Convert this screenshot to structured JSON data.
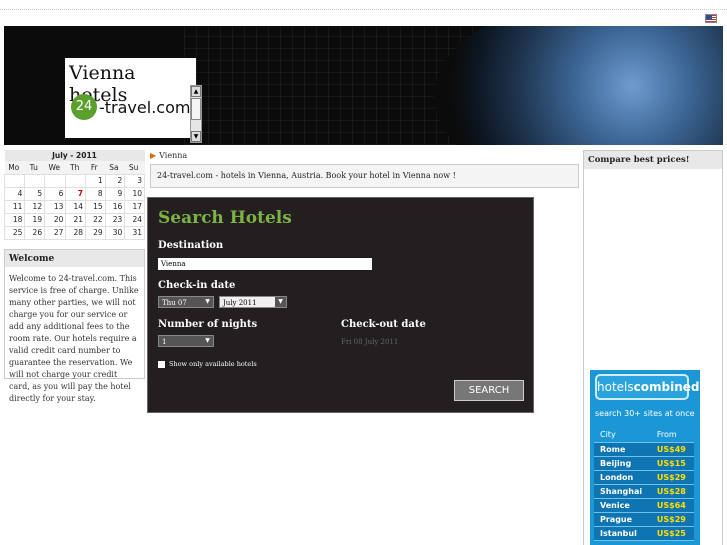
{
  "header": {
    "title": "Vienna hotels",
    "brand_number": "24",
    "brand_text": "-travel.com"
  },
  "calendar": {
    "month": "July - 2011",
    "days": [
      "Mo",
      "Tu",
      "We",
      "Th",
      "Fr",
      "Sa",
      "Su"
    ],
    "weeks": [
      [
        "",
        "",
        "",
        "",
        "1",
        "2",
        "3"
      ],
      [
        "4",
        "5",
        "6",
        "7",
        "8",
        "9",
        "10"
      ],
      [
        "11",
        "12",
        "13",
        "14",
        "15",
        "16",
        "17"
      ],
      [
        "18",
        "19",
        "20",
        "21",
        "22",
        "23",
        "24"
      ],
      [
        "25",
        "26",
        "27",
        "28",
        "29",
        "30",
        "31"
      ]
    ],
    "today": "7"
  },
  "welcome": {
    "title": "Welcome",
    "text": "Welcome to 24-travel.com. This service is free of charge. Unlike many other parties, we will not charge you for our service or add any additional fees to the room rate. Our hotels require a valid credit card number to guarantee the reservation. We will not charge your credit card, as you will pay the hotel directly for your stay."
  },
  "breadcrumb": "Vienna",
  "intro": "24-travel.com - hotels in Vienna, Austria. Book your hotel in Vienna now !",
  "search": {
    "title": "Search Hotels",
    "destination_label": "Destination",
    "destination_value": "Vienna",
    "checkin_label": "Check-in date",
    "checkin_day": "Thu 07",
    "checkin_month": "July 2011",
    "nights_label": "Number of nights",
    "nights_value": "1",
    "checkout_label": "Check-out date",
    "checkout_value": "Fri 08 July 2011",
    "available_label": "Show only available hotels",
    "button": "SEARCH"
  },
  "compare": {
    "title": "Compare best prices!"
  },
  "hotelscombined": {
    "logo_a": "hotels",
    "logo_b": "combined",
    "tagline": "search 30+ sites at once",
    "col_city": "City",
    "col_from": "From",
    "rows": [
      {
        "city": "Rome",
        "price": "US$49"
      },
      {
        "city": "Beijing",
        "price": "US$15"
      },
      {
        "city": "London",
        "price": "US$29"
      },
      {
        "city": "Shanghai",
        "price": "US$28"
      },
      {
        "city": "Venice",
        "price": "US$64"
      },
      {
        "city": "Prague",
        "price": "US$29"
      },
      {
        "city": "Istanbul",
        "price": "US$25"
      }
    ]
  },
  "colors": {
    "search_bg": "#231f20",
    "search_title": "#7cb342",
    "hc_blue": "#1b97d6"
  }
}
